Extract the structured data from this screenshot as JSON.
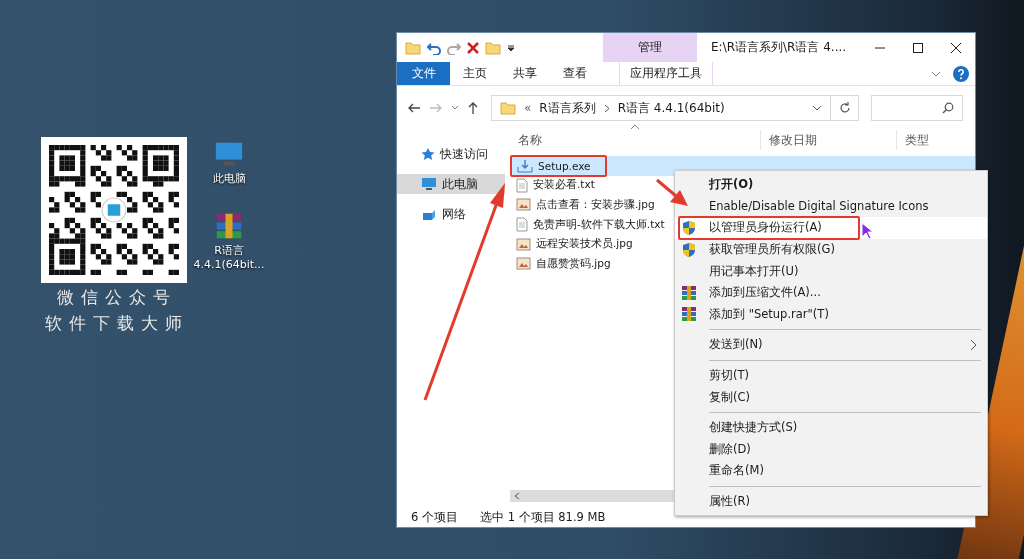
{
  "desktop": {
    "promo": {
      "caption_lines": [
        "微信公众号",
        "软件下载大师"
      ]
    },
    "icons": [
      {
        "kind": "computer",
        "label_lines": [
          "此电脑"
        ]
      },
      {
        "kind": "archive",
        "label_lines": [
          "R语言",
          "4.4.1(64bit..."
        ]
      }
    ]
  },
  "window": {
    "title": "E:\\R语言系列\\R语言 4....",
    "ribbon_tabs": [
      {
        "label": "文件",
        "kind": "file"
      },
      {
        "label": "主页",
        "kind": "plain"
      },
      {
        "label": "共享",
        "kind": "plain"
      },
      {
        "label": "查看",
        "kind": "plain"
      },
      {
        "label": "应用程序工具",
        "kind": "contextual",
        "group": "管理"
      }
    ],
    "address": {
      "overflow": "«",
      "crumbs": [
        "R语言系列",
        "R语言 4.4.1(64bit)"
      ]
    },
    "nav": [
      {
        "label": "快速访问",
        "kind": "star",
        "selected": false
      },
      {
        "label": "此电脑",
        "kind": "computer",
        "selected": true
      },
      {
        "label": "网络",
        "kind": "network",
        "selected": false
      }
    ],
    "columns": [
      "名称",
      "修改日期",
      "类型"
    ],
    "files": [
      {
        "name": "Setup.exe",
        "kind": "exe",
        "selected": true,
        "highlighted": true
      },
      {
        "name": "安装必看.txt",
        "kind": "text",
        "selected": false,
        "highlighted": false
      },
      {
        "name": "点击查看：安装步骤.jpg",
        "kind": "image",
        "selected": false,
        "highlighted": false
      },
      {
        "name": "免责声明-软件下载大师.txt",
        "kind": "text",
        "selected": false,
        "highlighted": false
      },
      {
        "name": "远程安装技术员.jpg",
        "kind": "image",
        "selected": false,
        "highlighted": false
      },
      {
        "name": "自愿赞赏码.jpg",
        "kind": "image",
        "selected": false,
        "highlighted": false
      }
    ],
    "status_bar": {
      "count": "6 个项目",
      "selection": "选中 1 个项目  81.9 MB"
    }
  },
  "context_menu": {
    "items": [
      {
        "kind": "default",
        "label": "打开(O)",
        "highlighted": false
      },
      {
        "kind": "plain",
        "label": "Enable/Disable Digital Signature Icons",
        "highlighted": false
      },
      {
        "kind": "shield",
        "label": "以管理员身份运行(A)",
        "highlighted": true
      },
      {
        "kind": "shield",
        "label": "获取管理员所有权限(G)",
        "highlighted": false
      },
      {
        "kind": "plain",
        "label": "用记事本打开(U)",
        "highlighted": false
      },
      {
        "kind": "archive",
        "label": "添加到压缩文件(A)...",
        "highlighted": false
      },
      {
        "kind": "archive",
        "label": "添加到 \"Setup.rar\"(T)",
        "highlighted": false
      },
      {
        "kind": "separator"
      },
      {
        "kind": "submenu",
        "label": "发送到(N)",
        "highlighted": false
      },
      {
        "kind": "separator"
      },
      {
        "kind": "plain",
        "label": "剪切(T)",
        "highlighted": false
      },
      {
        "kind": "plain",
        "label": "复制(C)",
        "highlighted": false
      },
      {
        "kind": "separator"
      },
      {
        "kind": "plain",
        "label": "创建快捷方式(S)",
        "highlighted": false
      },
      {
        "kind": "plain",
        "label": "删除(D)",
        "highlighted": false
      },
      {
        "kind": "plain",
        "label": "重命名(M)",
        "highlighted": false
      },
      {
        "kind": "separator"
      },
      {
        "kind": "plain",
        "label": "属性(R)",
        "highlighted": false
      }
    ]
  }
}
